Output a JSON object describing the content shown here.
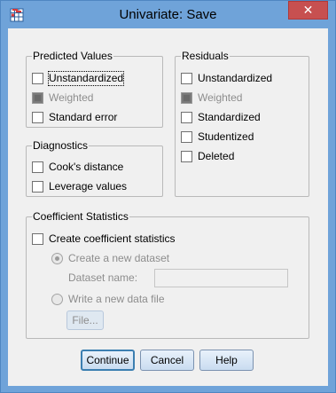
{
  "window": {
    "title": "Univariate: Save",
    "close_symbol": "✕",
    "accent_color": "#6fa3d9",
    "close_color": "#c75050"
  },
  "predicted_values": {
    "legend": "Predicted Values",
    "items": [
      {
        "label": "Unstandardized",
        "checked": false,
        "enabled": true
      },
      {
        "label": "Weighted",
        "checked": false,
        "enabled": false
      },
      {
        "label": "Standard error",
        "checked": false,
        "enabled": true
      }
    ]
  },
  "residuals": {
    "legend": "Residuals",
    "items": [
      {
        "label": "Unstandardized",
        "checked": false,
        "enabled": true
      },
      {
        "label": "Weighted",
        "checked": false,
        "enabled": false
      },
      {
        "label": "Standardized",
        "checked": false,
        "enabled": true
      },
      {
        "label": "Studentized",
        "checked": false,
        "enabled": true
      },
      {
        "label": "Deleted",
        "checked": false,
        "enabled": true
      }
    ]
  },
  "diagnostics": {
    "legend": "Diagnostics",
    "items": [
      {
        "label": "Cook's distance",
        "checked": false,
        "enabled": true
      },
      {
        "label": "Leverage values",
        "checked": false,
        "enabled": true
      }
    ]
  },
  "coefficient_statistics": {
    "legend": "Coefficient Statistics",
    "create_label": "Create coefficient statistics",
    "create_checked": false,
    "new_dataset_label": "Create a new dataset",
    "dataset_name_label": "Dataset name:",
    "dataset_name_value": "",
    "new_file_label": "Write a new data file",
    "file_button_label": "File..."
  },
  "buttons": {
    "continue": "Continue",
    "cancel": "Cancel",
    "help": "Help"
  }
}
